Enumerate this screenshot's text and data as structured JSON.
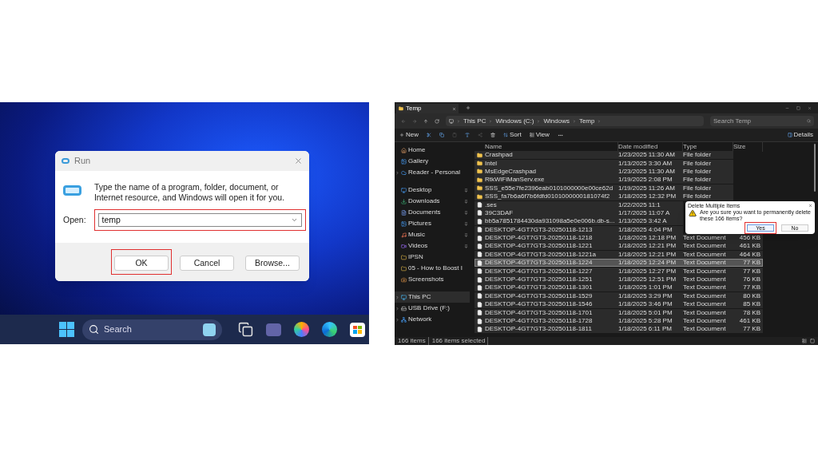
{
  "run_dialog": {
    "title": "Run",
    "message": "Type the name of a program, folder, document, or Internet resource, and Windows will open it for you.",
    "open_label": "Open:",
    "input": {
      "value": "temp",
      "highlighted": true
    },
    "buttons": [
      {
        "label": "OK",
        "highlighted": true
      },
      {
        "label": "Cancel",
        "highlighted": false
      },
      {
        "label": "Browse...",
        "highlighted": false
      }
    ]
  },
  "taskbar": {
    "search": {
      "placeholder": "Search"
    }
  },
  "explorer": {
    "tabs": [
      {
        "label": "Temp",
        "selected": true
      }
    ],
    "breadcrumb": [
      "This PC",
      "Windows (C:)",
      "Windows",
      "Temp"
    ],
    "search": {
      "placeholder": "Search Temp"
    },
    "toolbar": {
      "new_label": "New",
      "sort_label": "Sort",
      "view_label": "View",
      "details_label": "Details"
    },
    "sidebar": [
      {
        "kind": "home",
        "label": "Home",
        "pinned": false,
        "expandable": false,
        "selected": false
      },
      {
        "kind": "gallery",
        "label": "Gallery",
        "pinned": false,
        "expandable": false,
        "selected": false
      },
      {
        "kind": "cloud",
        "label": "Reader - Personal",
        "pinned": false,
        "expandable": true,
        "selected": false
      },
      {
        "kind": "desktop",
        "label": "Desktop",
        "pinned": true,
        "expandable": false,
        "selected": false
      },
      {
        "kind": "downloads",
        "label": "Downloads",
        "pinned": true,
        "expandable": false,
        "selected": false
      },
      {
        "kind": "documents",
        "label": "Documents",
        "pinned": true,
        "expandable": false,
        "selected": false
      },
      {
        "kind": "pictures",
        "label": "Pictures",
        "pinned": true,
        "expandable": false,
        "selected": false
      },
      {
        "kind": "music",
        "label": "Music",
        "pinned": true,
        "expandable": false,
        "selected": false
      },
      {
        "kind": "videos",
        "label": "Videos",
        "pinned": true,
        "expandable": false,
        "selected": false
      },
      {
        "kind": "folder",
        "label": "IPSN",
        "pinned": false,
        "expandable": false,
        "selected": false
      },
      {
        "kind": "folder",
        "label": "05 - How to Boost I",
        "pinned": false,
        "expandable": false,
        "selected": false
      },
      {
        "kind": "screenshots",
        "label": "Screenshots",
        "pinned": false,
        "expandable": false,
        "selected": false
      },
      {
        "kind": "pc",
        "label": "This PC",
        "pinned": false,
        "expandable": true,
        "selected": true
      },
      {
        "kind": "drive",
        "label": "USB Drive (F:)",
        "pinned": false,
        "expandable": true,
        "selected": false
      },
      {
        "kind": "network",
        "label": "Network",
        "pinned": false,
        "expandable": true,
        "selected": false
      }
    ],
    "columns": [
      "Name",
      "Date modified",
      "Type",
      "Size"
    ],
    "rows": [
      {
        "kind": "folder",
        "name": "Crashpad",
        "date": "1/23/2025 11:30 AM",
        "type": "File folder",
        "hovered": false
      },
      {
        "kind": "folder",
        "name": "Intel",
        "date": "1/13/2025 3:30 AM",
        "type": "File folder",
        "hovered": false
      },
      {
        "kind": "folder",
        "name": "MsEdgeCrashpad",
        "date": "1/23/2025 11:30 AM",
        "type": "File folder",
        "hovered": false
      },
      {
        "kind": "folder",
        "name": "RtkWiFiManServ.exe",
        "date": "1/19/2025 2:08 PM",
        "type": "File folder",
        "hovered": false
      },
      {
        "kind": "folder",
        "name": "SSS_e55e7fe2396eab0101000000e00ce62d",
        "date": "1/19/2025 11:26 AM",
        "type": "File folder",
        "hovered": false
      },
      {
        "kind": "folder",
        "name": "SSS_fa7b6a6f7b6fdfd0101000000181074f2",
        "date": "1/18/2025 12:32 PM",
        "type": "File folder",
        "hovered": false
      },
      {
        "kind": "file",
        "name": ".ses",
        "date": "1/22/2025 11:1",
        "hovered": false
      },
      {
        "kind": "file",
        "name": "39C3DAF",
        "date": "1/17/2025 11:07 A",
        "hovered": false
      },
      {
        "kind": "file",
        "name": "bb5a7851784430da931098a5e0e006b.db-s...",
        "date": "1/13/2025 3:42 A",
        "hovered": false
      },
      {
        "kind": "file",
        "name": "DESKTOP-4GT7GT3-20250118-1213",
        "date": "1/18/2025 4:04 PM",
        "hovered": false
      },
      {
        "kind": "file",
        "name": "DESKTOP-4GT7GT3-20250118-1218",
        "date": "1/18/2025 12:18 PM",
        "type": "Text Document",
        "size": "456 KB",
        "hovered": false
      },
      {
        "kind": "file",
        "name": "DESKTOP-4GT7GT3-20250118-1221",
        "date": "1/18/2025 12:21 PM",
        "type": "Text Document",
        "size": "461 KB",
        "hovered": false
      },
      {
        "kind": "file",
        "name": "DESKTOP-4GT7GT3-20250118-1221a",
        "date": "1/18/2025 12:21 PM",
        "type": "Text Document",
        "size": "464 KB",
        "hovered": false
      },
      {
        "kind": "file",
        "name": "DESKTOP-4GT7GT3-20250118-1224",
        "date": "1/18/2025 12:24 PM",
        "type": "Text Document",
        "size": "77 KB",
        "hovered": true
      },
      {
        "kind": "file",
        "name": "DESKTOP-4GT7GT3-20250118-1227",
        "date": "1/18/2025 12:27 PM",
        "type": "Text Document",
        "size": "77 KB",
        "hovered": false
      },
      {
        "kind": "file",
        "name": "DESKTOP-4GT7GT3-20250118-1251",
        "date": "1/18/2025 12:51 PM",
        "type": "Text Document",
        "size": "76 KB",
        "hovered": false
      },
      {
        "kind": "file",
        "name": "DESKTOP-4GT7GT3-20250118-1301",
        "date": "1/18/2025 1:01 PM",
        "type": "Text Document",
        "size": "77 KB",
        "hovered": false
      },
      {
        "kind": "file",
        "name": "DESKTOP-4GT7GT3-20250118-1529",
        "date": "1/18/2025 3:29 PM",
        "type": "Text Document",
        "size": "80 KB",
        "hovered": false
      },
      {
        "kind": "file",
        "name": "DESKTOP-4GT7GT3-20250118-1546",
        "date": "1/18/2025 3:46 PM",
        "type": "Text Document",
        "size": "85 KB",
        "hovered": false
      },
      {
        "kind": "file",
        "name": "DESKTOP-4GT7GT3-20250118-1701",
        "date": "1/18/2025 5:01 PM",
        "type": "Text Document",
        "size": "78 KB",
        "hovered": false
      },
      {
        "kind": "file",
        "name": "DESKTOP-4GT7GT3-20250118-1728",
        "date": "1/18/2025 5:28 PM",
        "type": "Text Document",
        "size": "461 KB",
        "hovered": false
      },
      {
        "kind": "file",
        "name": "DESKTOP-4GT7GT3-20250118-1811",
        "date": "1/18/2025 6:11 PM",
        "type": "Text Document",
        "size": "77 KB",
        "hovered": false
      }
    ],
    "status": [
      "166 items",
      "166 items selected"
    ],
    "dialog": {
      "title": "Delete Multiple Items",
      "message": "Are you sure you want to permanently delete these 166 items?",
      "buttons": [
        {
          "label": "Yes",
          "highlighted": true
        },
        {
          "label": "No",
          "highlighted": false
        }
      ]
    }
  }
}
